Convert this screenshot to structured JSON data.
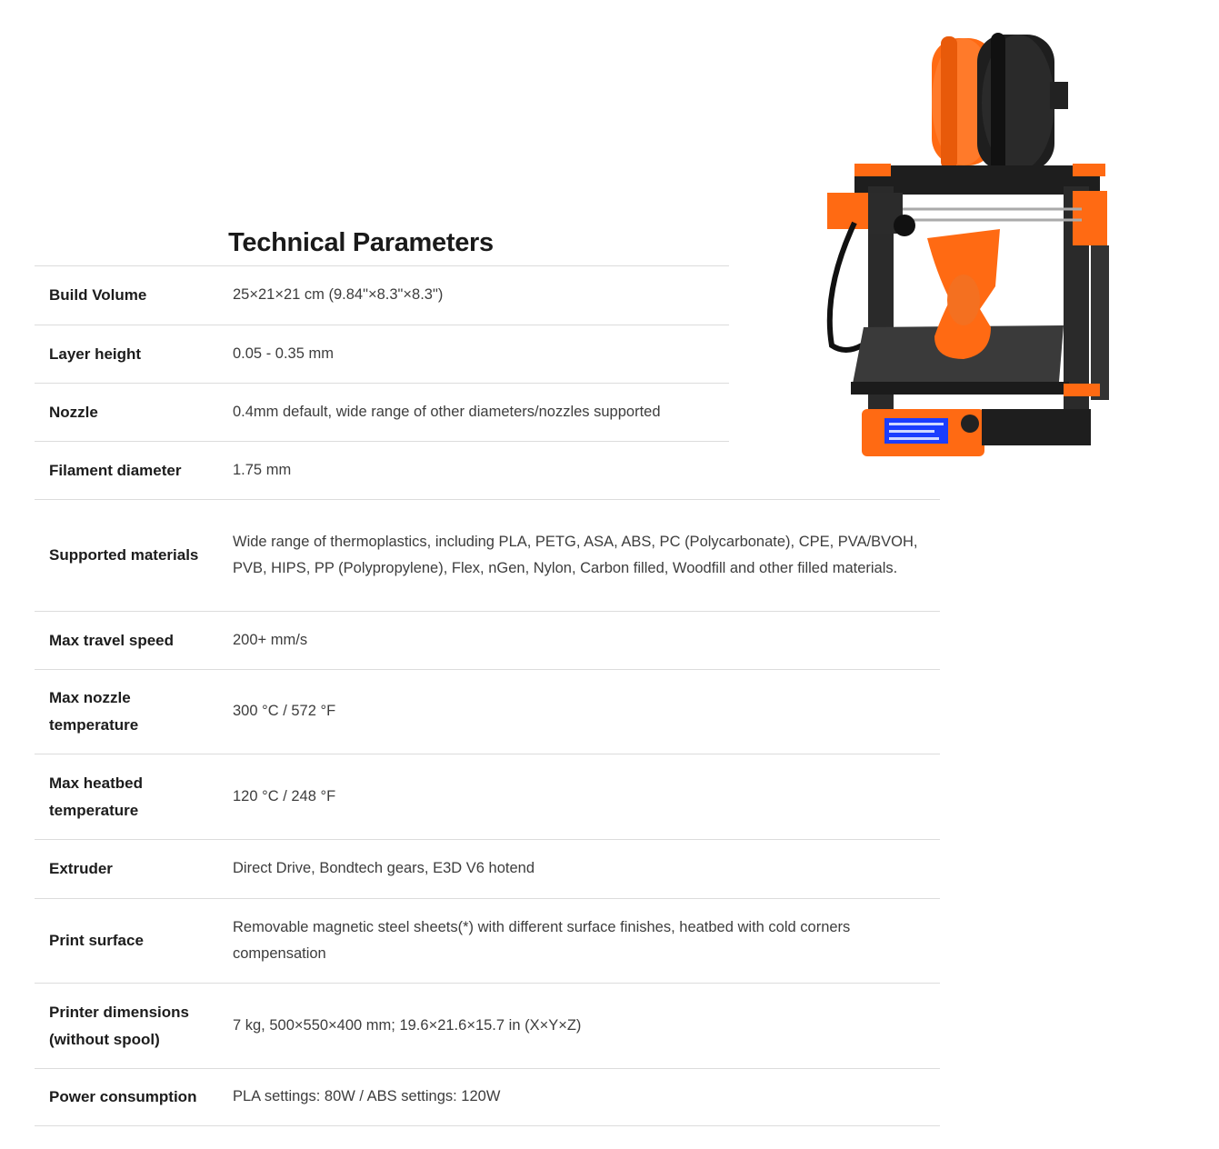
{
  "heading": "Technical Parameters",
  "specs": [
    {
      "label": "Build Volume",
      "value": "25×21×21 cm (9.84\"×8.3\"×8.3\")"
    },
    {
      "label": "Layer height",
      "value": "0.05 - 0.35 mm"
    },
    {
      "label": "Nozzle",
      "value": "0.4mm default, wide range of other diameters/nozzles supported"
    },
    {
      "label": "Filament diameter",
      "value": "1.75 mm"
    },
    {
      "label": "Supported materials",
      "value": "Wide range of thermoplastics, including PLA, PETG, ASA, ABS, PC (Polycarbonate), CPE, PVA/BVOH, PVB, HIPS, PP (Polypropylene), Flex, nGen, Nylon, Carbon filled, Woodfill and other filled materials."
    },
    {
      "label": "Max travel speed",
      "value": "200+ mm/s"
    },
    {
      "label": "Max nozzle temperature",
      "value": "300 °C / 572 °F"
    },
    {
      "label": "Max heatbed temperature",
      "value": "120 °C / 248 °F"
    },
    {
      "label": "Extruder",
      "value": "Direct Drive, Bondtech gears, E3D V6 hotend"
    },
    {
      "label": "Print surface",
      "value": "Removable magnetic steel sheets(*) with different surface finishes, heatbed with cold corners compensation"
    },
    {
      "label": "Printer dimensions (without spool)",
      "value": "7 kg, 500×550×400 mm; 19.6×21.6×15.7 in (X×Y×Z)"
    },
    {
      "label": "Power consumption",
      "value": "PLA settings: 80W / ABS settings: 120W"
    }
  ],
  "colors": {
    "accent_orange": "#ff6a13",
    "frame_black": "#1e1e1e",
    "divider": "#dcdcdc"
  },
  "image": {
    "subject": "printer-illustration"
  }
}
